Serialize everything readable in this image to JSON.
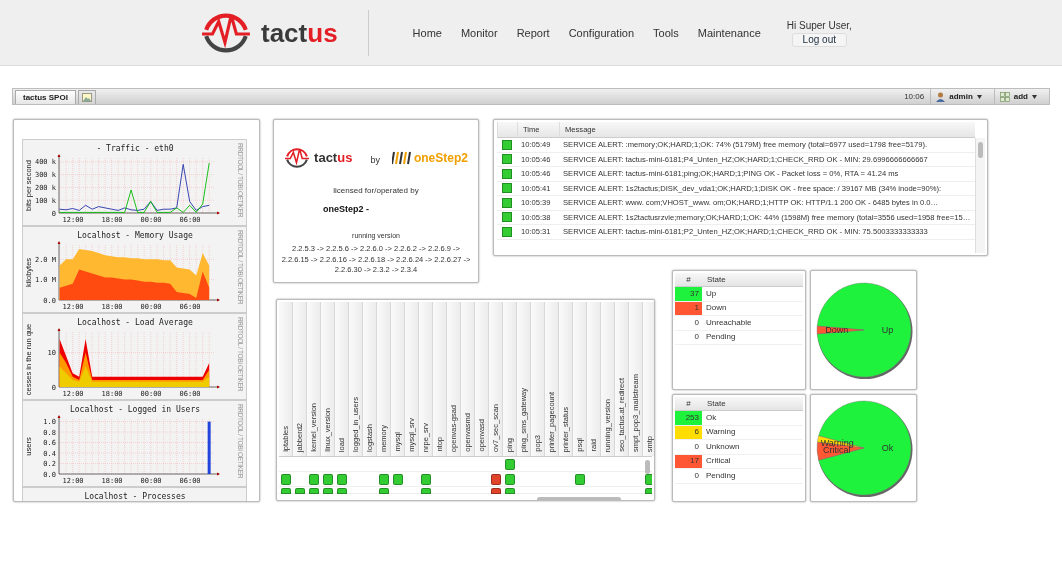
{
  "header": {
    "logo_text": [
      "tact",
      "us"
    ],
    "nav": [
      "Home",
      "Monitor",
      "Report",
      "Configuration",
      "Tools",
      "Maintenance"
    ],
    "greeting": "Hi Super User,",
    "logout": "Log out"
  },
  "toolbar": {
    "tabs": [
      {
        "kind": "text",
        "label": "tactus SPOI",
        "selected": true
      },
      {
        "kind": "icon",
        "selected": false
      }
    ],
    "time": "10:06",
    "user_menu": "admin",
    "add_menu": "add"
  },
  "graphs": [
    {
      "credit": "RRDTOOL / TOBI OETIKER",
      "time_axis": [
        "12:00",
        "18:00",
        "00:00",
        "06:00"
      ],
      "chart_data": {
        "type": "line",
        "title": "- Traffic - eth0",
        "ylabel": "bits per second",
        "grid": true,
        "ylim": [
          0,
          430000
        ],
        "yticks": [
          {
            "value": 0,
            "label": "0"
          },
          {
            "value": 100000,
            "label": "100 k"
          },
          {
            "value": 200000,
            "label": "200 k"
          },
          {
            "value": 300000,
            "label": "300 k"
          },
          {
            "value": 400000,
            "label": "400 k"
          }
        ],
        "series": [
          {
            "color": "#2233aa",
            "values": [
              30000,
              25000,
              35000,
              20000,
              60000,
              30000,
              50000,
              40000,
              30000,
              20000,
              40000,
              25000,
              20000,
              30000,
              90000,
              20000,
              30000,
              30000,
              40000,
              380000,
              90000,
              20000,
              50000,
              60000
            ]
          },
          {
            "color": "#00bb00",
            "values": [
              5000,
              5000,
              5000,
              5000,
              5000,
              5000,
              5000,
              5000,
              5000,
              5000,
              5000,
              180000,
              5000,
              5000,
              90000,
              5000,
              5000,
              5000,
              40000,
              5000,
              60000,
              5000,
              70000,
              390000
            ]
          }
        ]
      }
    },
    {
      "credit": "RRDTOOL / TOBI OETIKER",
      "time_axis": [
        "12:00",
        "18:00",
        "00:00",
        "06:00"
      ],
      "chart_data": {
        "type": "area",
        "title": "Localhost - Memory Usage",
        "ylabel": "kilobytes",
        "grid": true,
        "ylim": [
          0,
          2700000
        ],
        "stacked": false,
        "yticks": [
          {
            "value": 0,
            "label": "0.0"
          },
          {
            "value": 1000000,
            "label": "1.0 M"
          },
          {
            "value": 2000000,
            "label": "2.0 M"
          }
        ],
        "series": [
          {
            "color": "#ffb830",
            "values": [
              1700000,
              2000000,
              2000000,
              2500000,
              2450000,
              2400000,
              2300000,
              2200000,
              2150000,
              2100000,
              2100000,
              2050000,
              2050000,
              2000000,
              2000000,
              2000000,
              1950000,
              1950000,
              1600000,
              1550000,
              1500000,
              1200000,
              2300000,
              1700000
            ]
          },
          {
            "color": "#ff4a10",
            "values": [
              600000,
              700000,
              800000,
              1500000,
              1400000,
              1300000,
              1200000,
              1100000,
              1100000,
              1050000,
              1000000,
              1000000,
              950000,
              900000,
              900000,
              850000,
              850000,
              800000,
              400000,
              350000,
              300000,
              100000,
              1400000,
              600000
            ]
          }
        ]
      }
    },
    {
      "credit": "RRDTOOL / TOBI OETIKER",
      "time_axis": [
        "12:00",
        "18:00",
        "00:00",
        "06:00"
      ],
      "chart_data": {
        "type": "area",
        "title": "Localhost - Load Average",
        "ylabel": "cesses in the run que",
        "grid": true,
        "ylim": [
          0,
          16
        ],
        "stacked": false,
        "yticks": [
          0,
          10
        ],
        "series": [
          {
            "color": "#ee0000",
            "values": [
              14,
              9,
              4,
              3,
              14,
              3,
              3,
              3,
              3,
              3,
              3,
              3,
              3,
              3,
              3,
              3,
              3,
              3,
              3,
              3,
              3,
              3,
              3,
              7
            ]
          },
          {
            "color": "#ff9900",
            "values": [
              10,
              7,
              3,
              2,
              10,
              2,
              2,
              2,
              2,
              2,
              2,
              2,
              2,
              2,
              2,
              2,
              2,
              2,
              2,
              2,
              2,
              2,
              2,
              5
            ]
          },
          {
            "color": "#eecc00",
            "values": [
              6,
              4,
              2,
              1.5,
              6,
              1.5,
              1.5,
              1.5,
              1.5,
              1.5,
              1.5,
              1.5,
              1.5,
              1.5,
              1.5,
              1.5,
              1.5,
              1.5,
              1.5,
              1.5,
              1.5,
              1.5,
              1.5,
              3
            ]
          }
        ]
      }
    },
    {
      "credit": "RRDTOOL / TOBI OETIKER",
      "time_axis": [
        "12:00",
        "18:00",
        "00:00",
        "06:00"
      ],
      "chart_data": {
        "type": "bar",
        "title": "Localhost - Logged in Users",
        "ylabel": "users",
        "grid": true,
        "ylim": [
          0,
          1.05
        ],
        "yticks": [
          {
            "value": 0,
            "label": "0.0"
          },
          {
            "value": 0.2,
            "label": "0.2"
          },
          {
            "value": 0.4,
            "label": "0.4"
          },
          {
            "value": 0.6,
            "label": "0.6"
          },
          {
            "value": 0.8,
            "label": "0.8"
          },
          {
            "value": 1,
            "label": "1.0"
          }
        ],
        "series": [
          {
            "color": "#2244dd",
            "values": [
              null,
              null,
              null,
              null,
              null,
              null,
              null,
              null,
              null,
              null,
              null,
              null,
              null,
              null,
              null,
              null,
              null,
              null,
              null,
              null,
              null,
              null,
              null,
              1
            ]
          }
        ]
      }
    },
    {
      "title": "Localhost - Processes"
    }
  ],
  "about": {
    "logo_text": [
      "tact",
      "us"
    ],
    "by": "by",
    "partner": "oneStep2",
    "licensed": "licensed for/operated by",
    "licensee": "oneStep2 -",
    "version_label": "running version",
    "versions": "2.2.5.3 -> 2.2.5.6 -> 2.2.6.0 -> 2.2.6.2 -> 2.2.6.9 -> 2.2.6.15 -> 2.2.6.16 -> 2.2.6.18 -> 2.2.6.24 -> 2.2.6.27 -> 2.2.6.30 -> 2.3.2 -> 2.3.4"
  },
  "alerts": {
    "columns": [
      "Time",
      "Message"
    ],
    "rows": [
      {
        "color": "#33cc33",
        "time": "10:05:49",
        "message": "SERVICE ALERT: :memory;OK;HARD;1;OK: 74% (5179M) free memory (total=6977 used=1798 free=5179)."
      },
      {
        "color": "#33cc33",
        "time": "10:05:46",
        "message": "SERVICE ALERT: tactus-mini-6181;P4_Unten_HZ;OK;HARD;1;CHECK_RRD OK - MIN: 29.6996666666667"
      },
      {
        "color": "#33cc33",
        "time": "10:05:46",
        "message": "SERVICE ALERT: tactus-mini-6181;ping;OK;HARD;1;PING OK - Packet loss = 0%, RTA = 41.24 ms"
      },
      {
        "color": "#33cc33",
        "time": "10:05:41",
        "message": "SERVICE ALERT: 1s2tactus;DISK_dev_vda1;OK;HARD;1;DISK OK - free space: / 39167 MB (34% inode=90%):"
      },
      {
        "color": "#33cc33",
        "time": "10:05:39",
        "message": "SERVICE ALERT: www. com;VHOST_www. om;OK;HARD;1;HTTP OK: HTTP/1.1 200 OK - 6485 bytes in 0.0…"
      },
      {
        "color": "#33cc33",
        "time": "10:05:38",
        "message": "SERVICE ALERT: 1s2tactusrzvie;memory;OK;HARD;1;OK: 44% (1598M) free memory (total=3556 used=1958 free=15…"
      },
      {
        "color": "#33cc33",
        "time": "10:05:31",
        "message": "SERVICE ALERT: tactus-mini-6181;P2_Unten_HZ;OK;HARD;1;CHECK_RRD OK - MIN: 75.5003333333333"
      }
    ]
  },
  "matrix": {
    "services": [
      "iptables",
      "jabberd2",
      "kernel_version",
      "linux_version",
      "load",
      "logged_in_users",
      "logstash",
      "memory",
      "mysql",
      "mysql_srv",
      "nrpe_srv",
      "ntop",
      "openvas-gsad",
      "openvasmd",
      "openvasd",
      "ov7_sec_scan",
      "ping",
      "ping_sms_gateway",
      "pop3",
      "printer_pagecount",
      "printer_status",
      "psql",
      "raid",
      "running_version",
      "seo_tactus.at_redirect",
      "smpt_pop3_mailstream",
      "smtp"
    ],
    "rows": [
      {
        "cells": [
          null,
          null,
          null,
          null,
          null,
          null,
          null,
          null,
          null,
          null,
          null,
          null,
          null,
          null,
          null,
          null,
          {
            "color": "#33cc33"
          },
          null,
          null,
          null,
          null,
          null,
          null,
          null,
          null,
          null,
          null
        ]
      },
      {
        "cells": [
          {
            "color": "#33cc33"
          },
          null,
          {
            "color": "#33cc33"
          },
          {
            "color": "#33cc33"
          },
          {
            "color": "#33cc33"
          },
          null,
          null,
          {
            "color": "#33cc33"
          },
          {
            "color": "#33cc33"
          },
          null,
          {
            "color": "#33cc33"
          },
          null,
          null,
          null,
          null,
          {
            "color": "#e0442a"
          },
          {
            "color": "#33cc33"
          },
          null,
          null,
          null,
          null,
          {
            "color": "#33cc33"
          },
          null,
          null,
          null,
          null,
          {
            "color": "#33cc33"
          }
        ]
      },
      {
        "cells": [
          {
            "color": "#33cc33"
          },
          {
            "color": "#33cc33"
          },
          {
            "color": "#33cc33"
          },
          {
            "color": "#33cc33"
          },
          {
            "color": "#33cc33"
          },
          null,
          null,
          {
            "color": "#33cc33"
          },
          null,
          null,
          {
            "color": "#33cc33"
          },
          null,
          null,
          null,
          null,
          {
            "color": "#e0442a"
          },
          {
            "color": "#33cc33"
          },
          null,
          null,
          null,
          null,
          null,
          null,
          null,
          null,
          null,
          {
            "color": "#33cc33"
          }
        ]
      }
    ]
  },
  "host_states": {
    "columns": [
      "#",
      "State"
    ],
    "rows": [
      {
        "count": "37",
        "state": "Up",
        "color": "#1ef23c"
      },
      {
        "count": "1",
        "state": "Down",
        "color": "#ff5733"
      },
      {
        "count": "0",
        "state": "Unreachable"
      },
      {
        "count": "0",
        "state": "Pending"
      }
    ],
    "pie_labels": [
      {
        "text": "Down",
        "kind": "minor"
      },
      {
        "text": "Up",
        "kind": "major"
      }
    ]
  },
  "service_states": {
    "columns": [
      "#",
      "State"
    ],
    "rows": [
      {
        "count": "253",
        "state": "Ok",
        "color": "#1ef23c"
      },
      {
        "count": "6",
        "state": "Warning",
        "color": "#ffdd00"
      },
      {
        "count": "0",
        "state": "Unknown"
      },
      {
        "count": "17",
        "state": "Critical",
        "color": "#ff5733"
      },
      {
        "count": "0",
        "state": "Pending"
      }
    ],
    "pie_labels": [
      {
        "text": "Warning",
        "kind": "minor"
      },
      {
        "text": "Critical",
        "kind": "minor"
      },
      {
        "text": "Ok",
        "kind": "major"
      }
    ]
  }
}
